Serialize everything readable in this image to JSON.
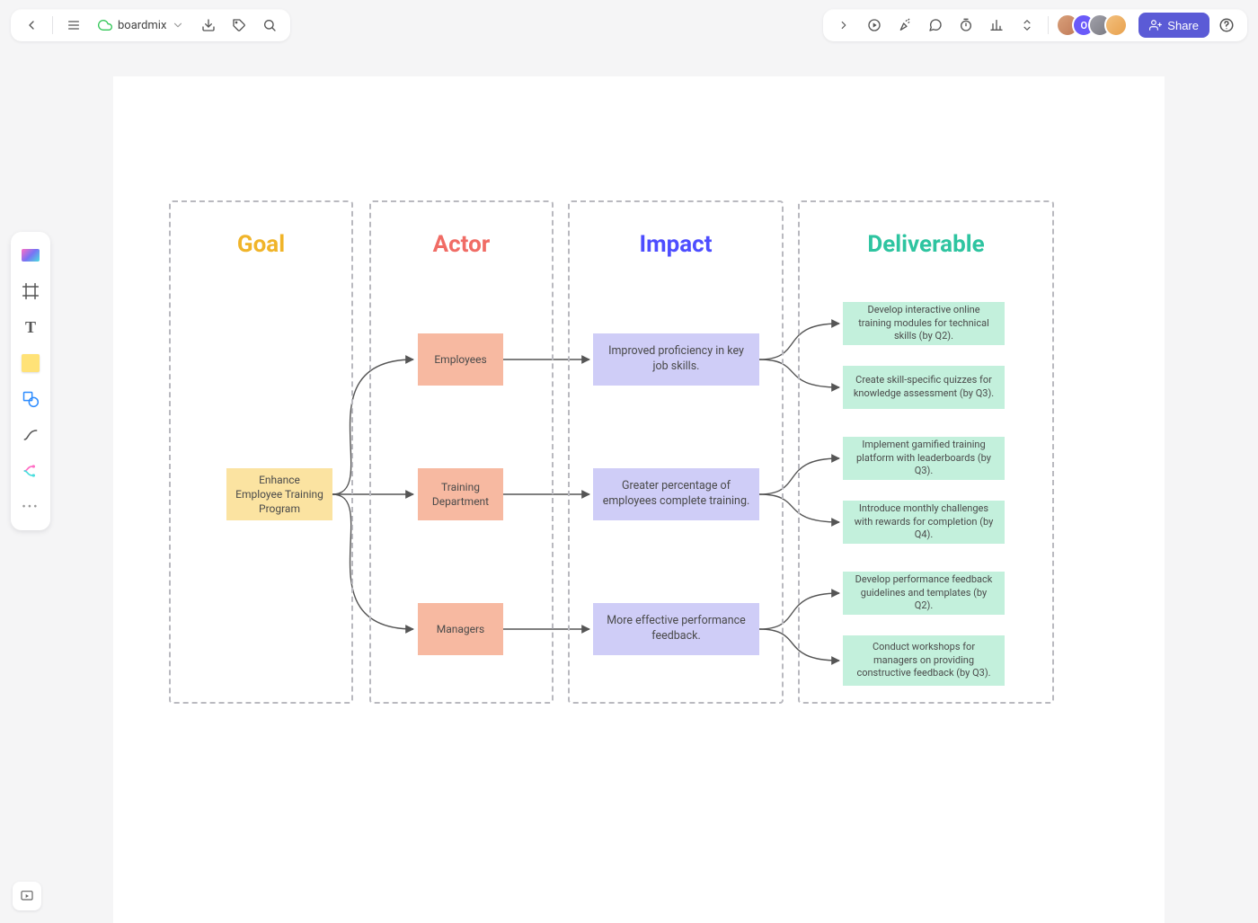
{
  "app": {
    "doc_name": "boardmix"
  },
  "share": {
    "label": "Share"
  },
  "diagram": {
    "columns": {
      "goal": {
        "title": "Goal"
      },
      "actor": {
        "title": "Actor"
      },
      "impact": {
        "title": "Impact"
      },
      "deliv": {
        "title": "Deliverable"
      }
    },
    "goal": {
      "text": "Enhance Employee Training Program"
    },
    "actors": [
      {
        "text": "Employees"
      },
      {
        "text": "Training Department"
      },
      {
        "text": "Managers"
      }
    ],
    "impacts": [
      {
        "text": "Improved proficiency in key job skills."
      },
      {
        "text": "Greater percentage of employees complete training."
      },
      {
        "text": "More effective performance feedback."
      }
    ],
    "deliverables": [
      {
        "text": "Develop interactive online training modules for technical skills (by Q2)."
      },
      {
        "text": "Create skill-specific quizzes for knowledge assessment (by Q3)."
      },
      {
        "text": "Implement gamified training platform with leaderboards (by Q3)."
      },
      {
        "text": "Introduce monthly challenges with rewards for completion (by Q4)."
      },
      {
        "text": "Develop performance feedback guidelines and templates (by Q2)."
      },
      {
        "text": "Conduct workshops for managers on providing constructive feedback (by Q3)."
      }
    ]
  }
}
